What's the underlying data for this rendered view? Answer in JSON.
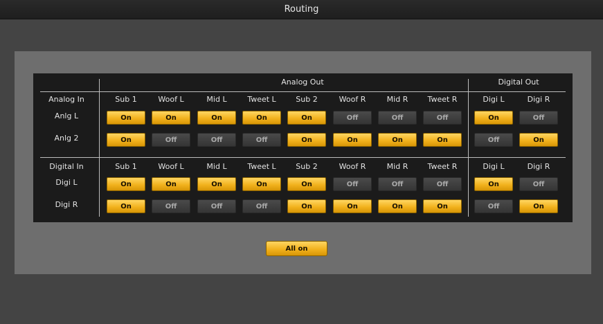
{
  "window": {
    "title": "Routing"
  },
  "header": {
    "analog_out": "Analog Out",
    "digital_out": "Digital Out"
  },
  "sections": [
    {
      "title": "Analog In",
      "columns": [
        "Sub 1",
        "Woof L",
        "Mid L",
        "Tweet L",
        "Sub 2",
        "Woof R",
        "Mid R",
        "Tweet R",
        "Digi L",
        "Digi R"
      ],
      "rows": [
        {
          "label": "Anlg L",
          "states": [
            "On",
            "On",
            "On",
            "On",
            "On",
            "Off",
            "Off",
            "Off",
            "On",
            "Off"
          ]
        },
        {
          "label": "Anlg 2",
          "states": [
            "On",
            "Off",
            "Off",
            "Off",
            "On",
            "On",
            "On",
            "On",
            "Off",
            "On"
          ]
        }
      ]
    },
    {
      "title": "Digital In",
      "columns": [
        "Sub 1",
        "Woof L",
        "Mid L",
        "Tweet L",
        "Sub 2",
        "Woof R",
        "Mid R",
        "Tweet R",
        "Digi L",
        "Digi R"
      ],
      "rows": [
        {
          "label": "Digi L",
          "states": [
            "On",
            "On",
            "On",
            "On",
            "On",
            "Off",
            "Off",
            "Off",
            "On",
            "Off"
          ]
        },
        {
          "label": "Digi R",
          "states": [
            "On",
            "Off",
            "Off",
            "Off",
            "On",
            "On",
            "On",
            "On",
            "Off",
            "On"
          ]
        }
      ]
    }
  ],
  "all_on_button": "All on",
  "colors": {
    "on": "#f2b21e",
    "off": "#3d3d3d",
    "background": "#444444",
    "panel": "#6e6e6e"
  }
}
